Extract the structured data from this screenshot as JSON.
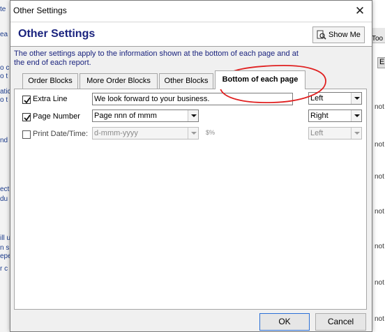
{
  "background": {
    "left_fragments": [
      "te",
      "ea",
      "o c",
      "o t",
      "atic",
      "o t",
      "nd",
      "ect",
      "du",
      "ill u",
      "n sp",
      "epe",
      "r c"
    ],
    "right_toolbar": "Too",
    "right_header": "E",
    "right_notes": [
      "not",
      "not",
      "not",
      "not",
      "not",
      "not",
      "not"
    ]
  },
  "dialog": {
    "title": "Other Settings",
    "header_title": "Other Settings",
    "show_me_label": "Show Me",
    "description": "The other settings apply to the information shown at the bottom of each page and at the end of each report."
  },
  "tabs": [
    {
      "label": "Order Blocks",
      "active": false
    },
    {
      "label": "More Order Blocks",
      "active": false
    },
    {
      "label": "Other Blocks",
      "active": false
    },
    {
      "label": "Bottom of each page",
      "active": true
    }
  ],
  "rows": {
    "extra_line": {
      "checked": true,
      "label": "Extra Line",
      "value": "We look forward to your business.",
      "align": "Left"
    },
    "page_number": {
      "checked": true,
      "label": "Page Number",
      "value": "Page nnn of mmm",
      "align": "Right"
    },
    "print_date": {
      "checked": false,
      "label": "Print Date/Time:",
      "value": "d-mmm-yyyy",
      "symbol": "$%",
      "align": "Left"
    }
  },
  "buttons": {
    "ok": "OK",
    "cancel": "Cancel"
  },
  "colors": {
    "accent_text": "#1a237e",
    "annotation": "#e02020"
  }
}
